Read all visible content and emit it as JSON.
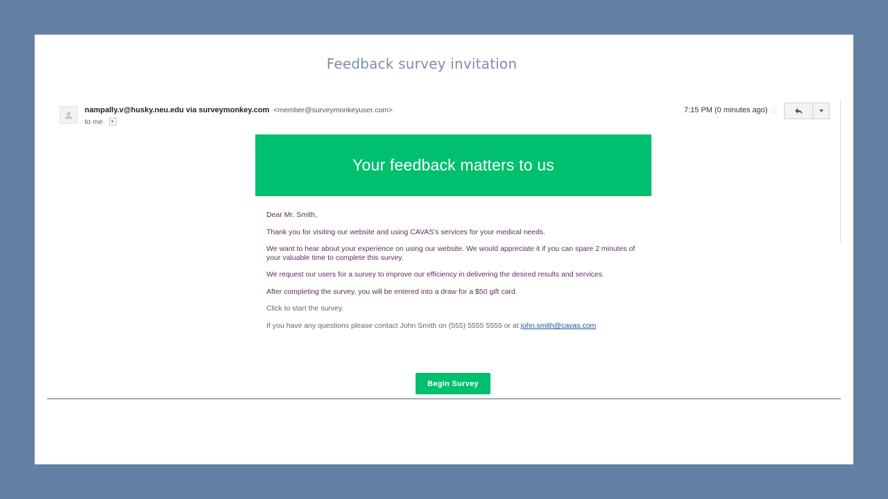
{
  "slide": {
    "title": "Feedback survey invitation"
  },
  "email": {
    "sender_name": "nampally.v@husky.neu.edu via surveymonkey.com",
    "sender_address": "<member@surveymonkeyuser.com>",
    "recipient": "to me",
    "timestamp": "7:15 PM (0 minutes ago)",
    "icons": [
      "avatar-icon",
      "star-icon",
      "reply-icon",
      "more-dropdown-icon"
    ]
  },
  "banner": {
    "text": "Your feedback matters to us",
    "color": "#00bf6f"
  },
  "message": {
    "greeting": "Dear Mr. Smith,",
    "p1": "Thank you for visiting our website and using CAVAS's services for your medical needs.",
    "p2": "We want to hear about your experience on using our website. We would appreciate it if you can spare 2 minutes of your valuable time to complete this survey.",
    "p3": "We request our users for a survey to improve our efficiency in delivering the desired results and services.",
    "p4": "After completing the survey, you will be entered into a draw for a $50 gift card.",
    "p5": "Click to start the survey.",
    "contact_text": "If you have any questions please contact John Smith on (555) 5555 5555 or at ",
    "contact_email": "john.smith@cavas.com"
  },
  "cta": {
    "label": "Begin Survey"
  },
  "colors": {
    "background": "#6480a2",
    "accent": "#00bf6f",
    "body_text": "#5a2e5e",
    "link": "#1a4f98"
  }
}
